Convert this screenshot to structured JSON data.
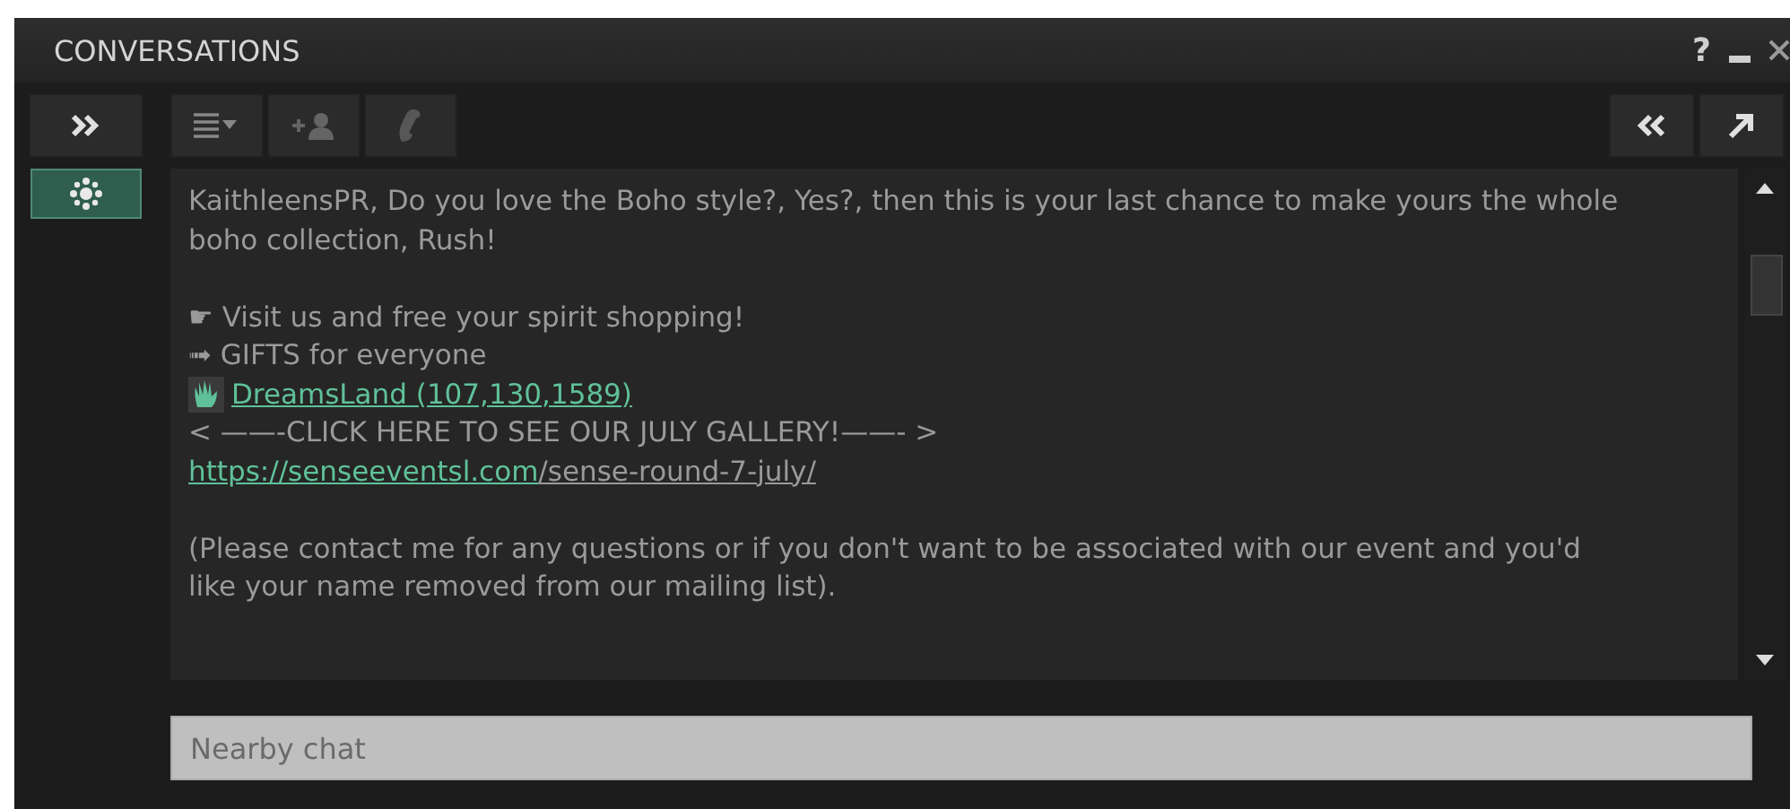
{
  "window": {
    "title": "CONVERSATIONS",
    "help": "?"
  },
  "conversations": [
    {
      "selected": true
    }
  ],
  "toolbar": {
    "add_person_disabled": true,
    "call_disabled": true
  },
  "messages": [
    {
      "kind": "text",
      "text": "KaithleensPR, Do you love the Boho style?, Yes?, then this is your last chance to make yours the whole boho collection, Rush!"
    },
    {
      "kind": "blank"
    },
    {
      "kind": "text",
      "text": "☛ Visit us and free your spirit shopping!"
    },
    {
      "kind": "text",
      "text": "➟ GIFTS for everyone"
    },
    {
      "kind": "slurl",
      "link": "DreamsLand (107,130,1589)"
    },
    {
      "kind": "text",
      "text": "< ——-CLICK HERE TO SEE OUR JULY GALLERY!——- >"
    },
    {
      "kind": "url",
      "link": "https://senseeventsl.com",
      "rest": "/sense-round-7-july/"
    },
    {
      "kind": "blank"
    },
    {
      "kind": "text",
      "text": "(Please contact me for any questions or if you don't want to be associated with our event and you'd like your name removed from our mailing list)."
    }
  ],
  "input": {
    "placeholder": "Nearby chat"
  }
}
